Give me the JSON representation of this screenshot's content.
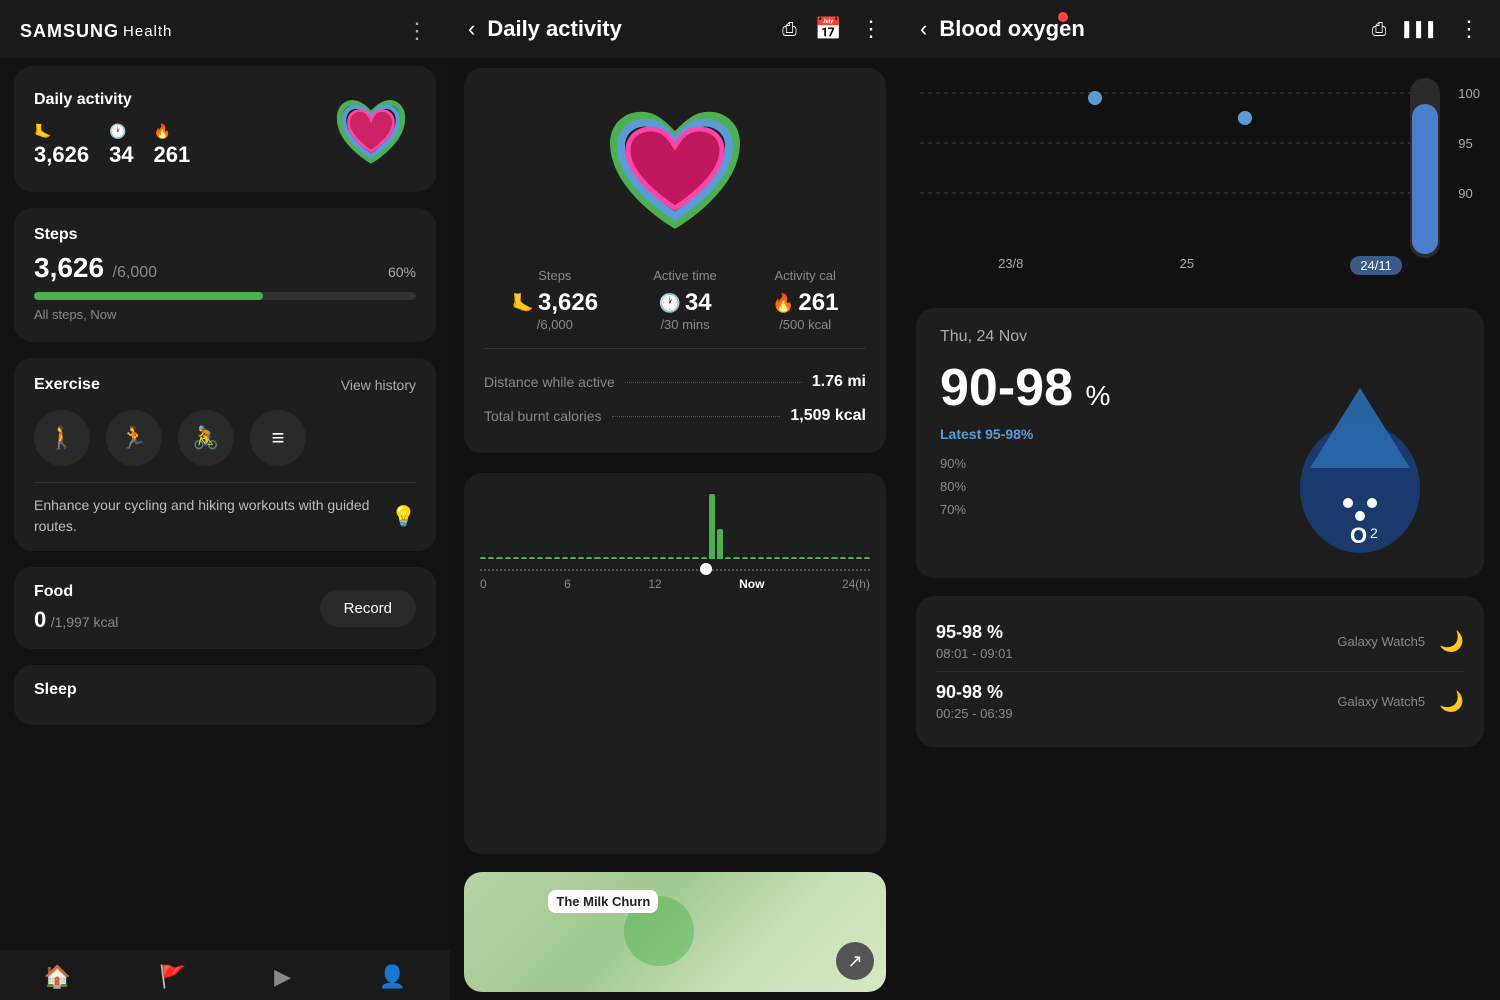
{
  "left": {
    "app_name": "SAMSUNG",
    "app_name2": "Health",
    "more_icon": "⋮",
    "daily_activity": {
      "title": "Daily activity",
      "steps_value": "3,626",
      "active_value": "34",
      "calories_value": "261"
    },
    "steps": {
      "title": "Steps",
      "value": "3,626",
      "goal": "/6,000",
      "percent": "60%",
      "subtitle": "All steps, Now",
      "fill_width": "60%"
    },
    "exercise": {
      "title": "Exercise",
      "view_history": "View history",
      "tip": "Enhance your cycling and hiking workouts with guided routes."
    },
    "food": {
      "title": "Food",
      "value": "0",
      "goal": "/1,997 kcal",
      "record_btn": "Record"
    },
    "sleep": {
      "title": "Sleep"
    }
  },
  "middle": {
    "back": "‹",
    "title": "Daily activity",
    "share_icon": "⎙",
    "calendar_icon": "📅",
    "more_icon": "⋮",
    "steps_label": "Steps",
    "steps_value": "3,626",
    "steps_sub": "/6,000",
    "active_label": "Active time",
    "active_value": "34",
    "active_sub": "/30 mins",
    "cal_label": "Activity cal",
    "cal_value": "261",
    "cal_sub": "/500 kcal",
    "distance_label": "Distance while active",
    "distance_value": "1.76 mi",
    "total_cal_label": "Total burnt calories",
    "total_cal_value": "1,509 kcal",
    "chart_labels": [
      "0",
      "6",
      "12",
      "Now",
      "24(h)"
    ],
    "map_label": "The Milk Churn"
  },
  "right": {
    "back": "‹",
    "title": "Blood oxygen",
    "share_icon": "⎙",
    "bars_icon": "▌▌▌",
    "more_icon": "⋮",
    "chart_dates": [
      "23/8",
      "25",
      "24/11"
    ],
    "chart_values": [
      100,
      95,
      90
    ],
    "date": "Thu, 24 Nov",
    "range": "90-98",
    "percent_symbol": "%",
    "latest_label": "Latest 95-98%",
    "scale": [
      "90%",
      "80%",
      "70%"
    ],
    "o2_symbol": "O₂",
    "records": [
      {
        "range": "95-98 %",
        "time": "08:01 - 09:01",
        "device": "Galaxy Watch5",
        "icon": "🌙"
      },
      {
        "range": "90-98 %",
        "time": "00:25 - 06:39",
        "device": "Galaxy Watch5",
        "icon": "🌙"
      }
    ]
  }
}
